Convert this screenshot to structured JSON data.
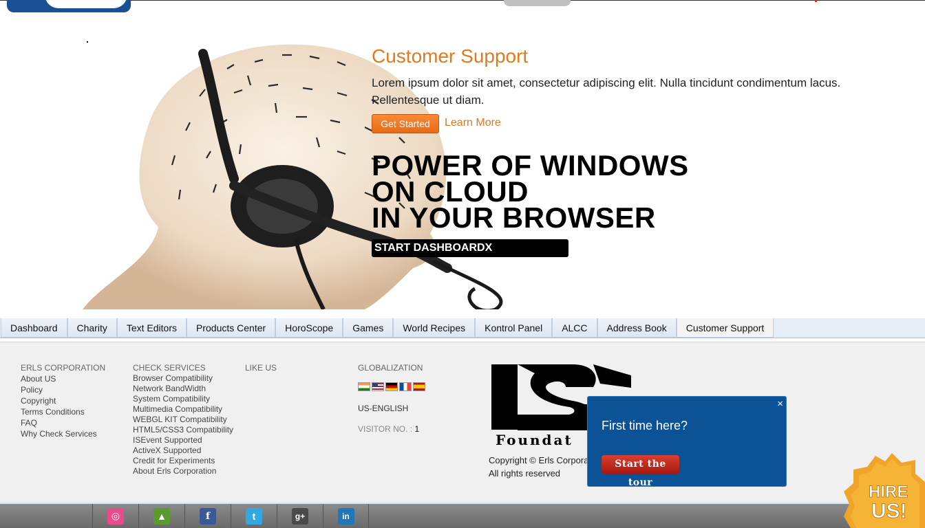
{
  "hero": {
    "title": "Customer Support",
    "description": "Lorem ipsum dolor sit amet, consectetur adipiscing elit. Nulla tincidunt condimentum lacus. Pellentesque ut diam.",
    "get_started": "Get Started",
    "learn_more": "Learn More",
    "headline": [
      "POWER OF WINDOWS",
      "ON CLOUD",
      "IN YOUR BROWSER"
    ],
    "dashboard_button": "START DASHBOARDX"
  },
  "nav": {
    "tabs": [
      "Dashboard",
      "Charity",
      "Text Editors",
      "Products Center",
      "HoroScope",
      "Games",
      "World Recipes",
      "Kontrol Panel",
      "ALCC",
      "Address Book",
      "Customer Support"
    ],
    "active": "Customer Support"
  },
  "footer": {
    "company": {
      "heading": "ERLS CORPORATION",
      "links": [
        "About US",
        "Policy",
        "Copyright",
        "Terms Conditions",
        "FAQ",
        "Why Check Services"
      ]
    },
    "services": {
      "heading": "CHECK SERVICES",
      "links": [
        "Browser Compatibility",
        "Network BandWidth",
        "System Compatibility",
        "Multimedia Compatibility",
        "WEBGL KIT Compatibility",
        "HTML5/CSS3 Compatibility",
        "ISEvent Supported",
        "ActiveX Supported",
        "Credit for Experiments",
        "About Erls Corporation"
      ]
    },
    "like": {
      "heading": "LIKE US"
    },
    "globalization": {
      "heading": "GLOBALIZATION",
      "flags": [
        "india-flag",
        "usa-flag",
        "germany-flag",
        "france-flag",
        "spain-flag"
      ],
      "language": "US-ENGLISH",
      "visitor_label": "VISITOR NO. :",
      "visitor_count": "1"
    },
    "logo_text": "Foundat",
    "copyright_line1": "Copyright © Erls Corpora",
    "copyright_line2": "All rights reserved"
  },
  "popup": {
    "close": "×",
    "question": "First time here?",
    "button": "Start the tour"
  },
  "social": [
    {
      "name": "dribbble-icon",
      "glyph": "◎",
      "color": "#ea4c89"
    },
    {
      "name": "forrst-icon",
      "glyph": "▲",
      "color": "#5b9a2f"
    },
    {
      "name": "facebook-icon",
      "glyph": "f",
      "color": "#3b5998"
    },
    {
      "name": "twitter-icon",
      "glyph": "t",
      "color": "#33a7e0"
    },
    {
      "name": "googleplus-icon",
      "glyph": "g+",
      "color": "#4a4a4a"
    },
    {
      "name": "linkedin-icon",
      "glyph": "in",
      "color": "#1f76b8"
    }
  ],
  "hire_badge": {
    "line1": "HIRE",
    "line2": "US!"
  },
  "colors": {
    "accent": "#e07a20",
    "popup": "#0b5297",
    "nav": "#e4ecf5"
  }
}
